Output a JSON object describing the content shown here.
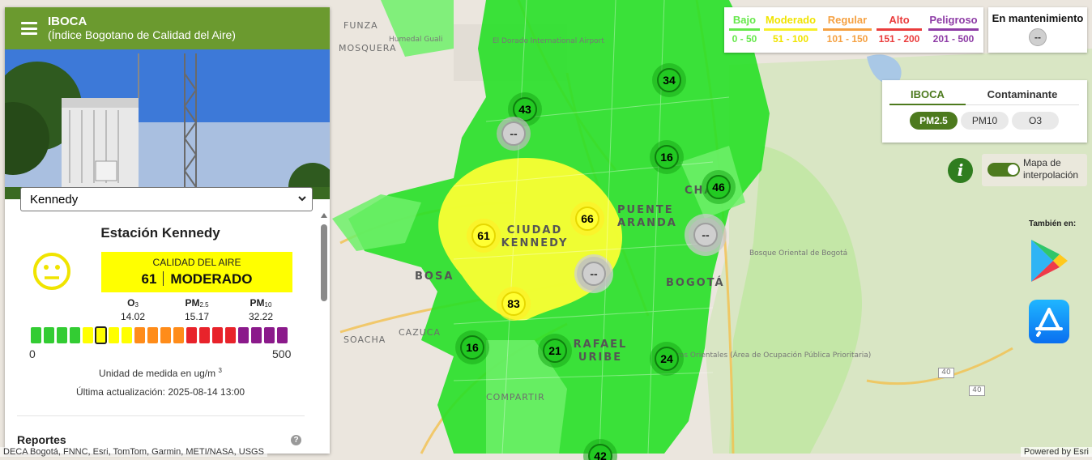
{
  "app": {
    "title": "IBOCA",
    "subtitle": "(Índice Bogotano de Calidad del Aire)"
  },
  "station": {
    "selected": "Kennedy",
    "name": "Estación Kennedy",
    "quality_label": "CALIDAD DEL AIRE",
    "index_value": "61",
    "category": "MODERADO",
    "pollutants": [
      {
        "name": "O",
        "sub": "3",
        "value": "14.02"
      },
      {
        "name": "PM",
        "sub": "2.5",
        "value": "15.17"
      },
      {
        "name": "PM",
        "sub": "10",
        "value": "32.22"
      }
    ],
    "scale_min": "0",
    "scale_max": "500",
    "scale_level_segment": 5,
    "unit_text": "Unidad de medida en ug/m",
    "unit_sup": "3",
    "updated": "Última actualización: 2025-08-14 13:00"
  },
  "reports": {
    "label": "Reportes"
  },
  "legend": [
    {
      "label": "Bajo",
      "range": "0 - 50",
      "color": "#66e84b"
    },
    {
      "label": "Moderado",
      "range": "51 - 100",
      "color": "#f7ef2a"
    },
    {
      "label": "Regular",
      "range": "101 - 150",
      "color": "#f5a142"
    },
    {
      "label": "Alto",
      "range": "151 - 200",
      "color": "#ea3c3c"
    },
    {
      "label": "Peligroso",
      "range": "201 - 500",
      "color": "#8e3ca6"
    }
  ],
  "maintenance": {
    "label": "En mantenimiento",
    "value": "--"
  },
  "view_tabs": {
    "iboca": "IBOCA",
    "contaminante": "Contaminante"
  },
  "pollutant_pills": {
    "pm25": "PM2.5",
    "pm10": "PM10",
    "o3": "O3"
  },
  "interpolation": {
    "label": "Mapa de interpolación",
    "enabled": true
  },
  "also_on": "También en:",
  "map_labels": {
    "funza": "FUNZA",
    "mosquera": "MOSQUERA",
    "humedal": "Humedal Guali",
    "airport": "El Dorado International Airport",
    "ciudad_kennedy": "CIUDAD KENNEDY",
    "bogota": "BOGOTÁ",
    "bosa": "BOSA",
    "cazuca": "CAZUCA",
    "soacha": "SOACHA",
    "rafael_uribe": "RAFAEL URIBE",
    "compartir": "COMPARTIR",
    "chapinero": "CHAP",
    "puente_aranda": "PUENTE ARANDA",
    "bosque": "Bosque Oriental de Bogotá",
    "cerros": "Cerros Orientales (Área de Ocupación Pública Prioritaria)",
    "road_40a": "40",
    "road_40b": "40"
  },
  "stations_map": [
    {
      "value": "43",
      "status": "green"
    },
    {
      "value": "--",
      "status": "gray"
    },
    {
      "value": "34",
      "status": "green"
    },
    {
      "value": "16",
      "status": "green"
    },
    {
      "value": "46",
      "status": "green"
    },
    {
      "value": "66",
      "status": "yellow"
    },
    {
      "value": "61",
      "status": "yellow"
    },
    {
      "value": "--",
      "status": "gray"
    },
    {
      "value": "--",
      "status": "gray"
    },
    {
      "value": "83",
      "status": "yellow"
    },
    {
      "value": "16",
      "status": "green"
    },
    {
      "value": "21",
      "status": "green"
    },
    {
      "value": "24",
      "status": "green"
    },
    {
      "value": "42",
      "status": "green"
    }
  ],
  "attribution": "DECA Bogotá, FNNC, Esri, TomTom, Garmin, METI/NASA, USGS",
  "powered_by": "Powered by Esri",
  "colors": {
    "header_green": "#6b9a2f",
    "moderate_yellow": "#ffff00",
    "accent_green": "#4d7a1e"
  }
}
